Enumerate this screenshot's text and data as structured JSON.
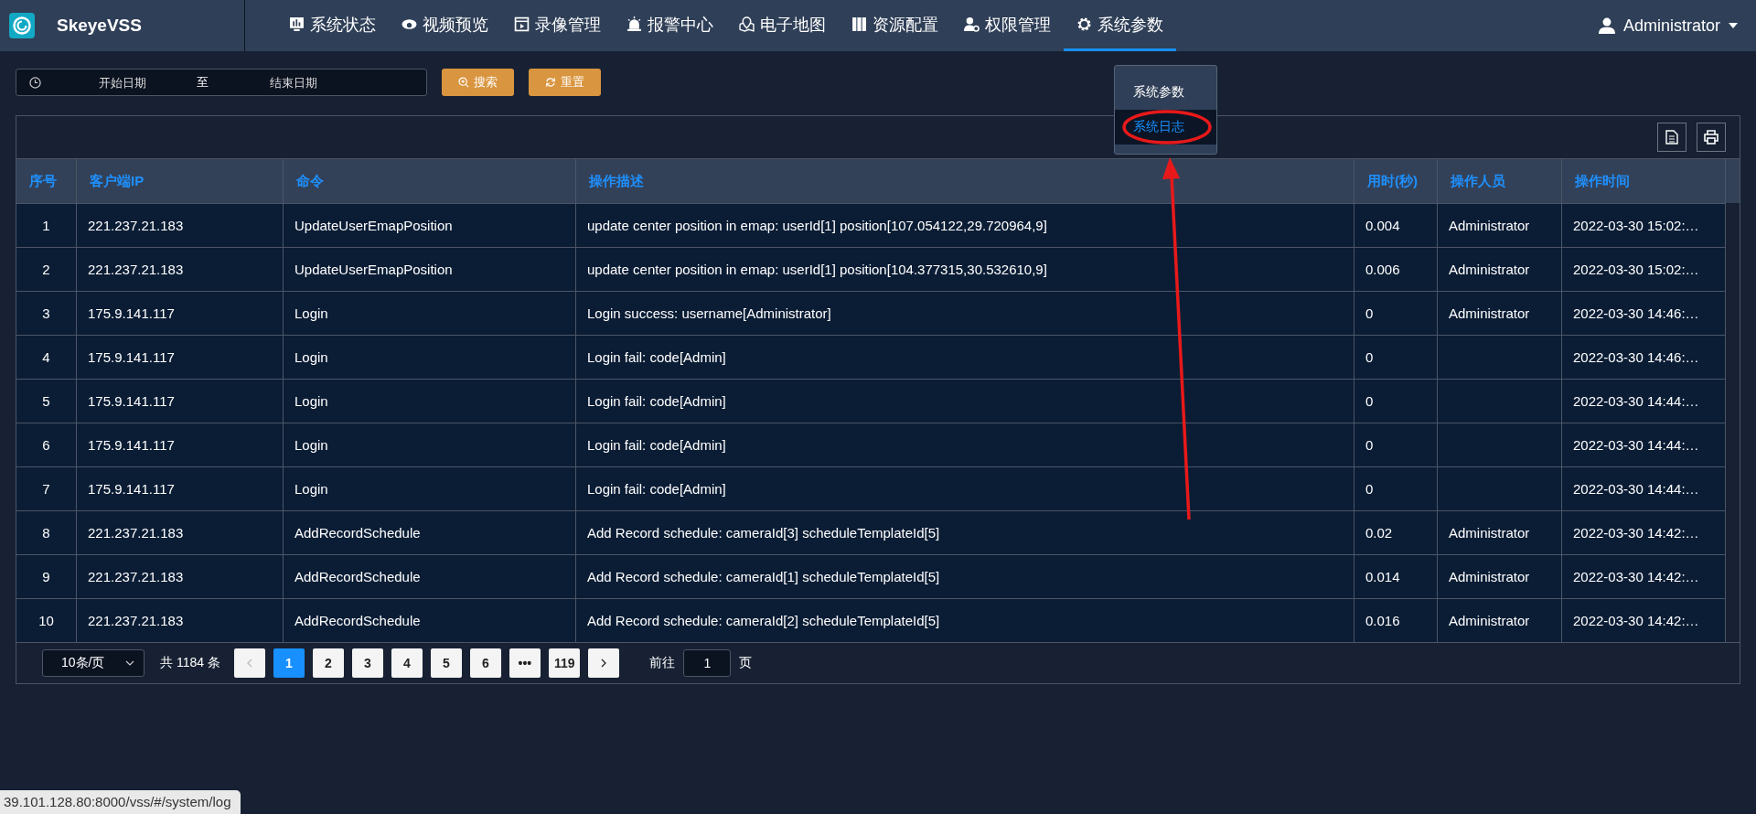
{
  "brand": {
    "name": "SkeyeVSS"
  },
  "nav": {
    "items": [
      {
        "label": "系统状态",
        "selected": false
      },
      {
        "label": "视频预览",
        "selected": false
      },
      {
        "label": "录像管理",
        "selected": false
      },
      {
        "label": "报警中心",
        "selected": false
      },
      {
        "label": "电子地图",
        "selected": false
      },
      {
        "label": "资源配置",
        "selected": false
      },
      {
        "label": "权限管理",
        "selected": false
      },
      {
        "label": "系统参数",
        "selected": true
      }
    ],
    "user": "Administrator"
  },
  "dropdown": {
    "items": [
      {
        "label": "系统参数",
        "selected": false
      },
      {
        "label": "系统日志",
        "selected": true
      }
    ]
  },
  "filter": {
    "start_placeholder": "开始日期",
    "separator": "至",
    "end_placeholder": "结束日期",
    "search_button": "搜索",
    "reset_button": "重置"
  },
  "table": {
    "columns": [
      "序号",
      "客户端IP",
      "命令",
      "操作描述",
      "用时(秒)",
      "操作人员",
      "操作时间"
    ],
    "rows": [
      [
        "1",
        "221.237.21.183",
        "UpdateUserEmapPosition",
        "update center position in emap: userId[1] position[107.054122,29.720964,9]",
        "0.004",
        "Administrator",
        "2022-03-30 15:02:…"
      ],
      [
        "2",
        "221.237.21.183",
        "UpdateUserEmapPosition",
        "update center position in emap: userId[1] position[104.377315,30.532610,9]",
        "0.006",
        "Administrator",
        "2022-03-30 15:02:…"
      ],
      [
        "3",
        "175.9.141.117",
        "Login",
        "Login success: username[Administrator]",
        "0",
        "Administrator",
        "2022-03-30 14:46:…"
      ],
      [
        "4",
        "175.9.141.117",
        "Login",
        "Login fail: code[Admin]",
        "0",
        "",
        "2022-03-30 14:46:…"
      ],
      [
        "5",
        "175.9.141.117",
        "Login",
        "Login fail: code[Admin]",
        "0",
        "",
        "2022-03-30 14:44:…"
      ],
      [
        "6",
        "175.9.141.117",
        "Login",
        "Login fail: code[Admin]",
        "0",
        "",
        "2022-03-30 14:44:…"
      ],
      [
        "7",
        "175.9.141.117",
        "Login",
        "Login fail: code[Admin]",
        "0",
        "",
        "2022-03-30 14:44:…"
      ],
      [
        "8",
        "221.237.21.183",
        "AddRecordSchedule",
        "Add Record schedule: cameraId[3] scheduleTemplateId[5]",
        "0.02",
        "Administrator",
        "2022-03-30 14:42:…"
      ],
      [
        "9",
        "221.237.21.183",
        "AddRecordSchedule",
        "Add Record schedule: cameraId[1] scheduleTemplateId[5]",
        "0.014",
        "Administrator",
        "2022-03-30 14:42:…"
      ],
      [
        "10",
        "221.237.21.183",
        "AddRecordSchedule",
        "Add Record schedule: cameraId[2] scheduleTemplateId[5]",
        "0.016",
        "Administrator",
        "2022-03-30 14:42:…"
      ]
    ]
  },
  "pagination": {
    "page_size": "10条/页",
    "total": "共 1184 条",
    "prev": {
      "disabled": true
    },
    "next": {
      "disabled": false
    },
    "pages": [
      {
        "label": "1",
        "selected": true
      },
      {
        "label": "2",
        "selected": false
      },
      {
        "label": "3",
        "selected": false
      },
      {
        "label": "4",
        "selected": false
      },
      {
        "label": "5",
        "selected": false
      },
      {
        "label": "6",
        "selected": false
      },
      {
        "label": "•••",
        "selected": false
      },
      {
        "label": "119",
        "selected": false
      }
    ],
    "goto_label": "前往",
    "goto_value": "1",
    "goto_suffix": "页"
  },
  "status_url": "39.101.128.80:8000/vss/#/system/log"
}
